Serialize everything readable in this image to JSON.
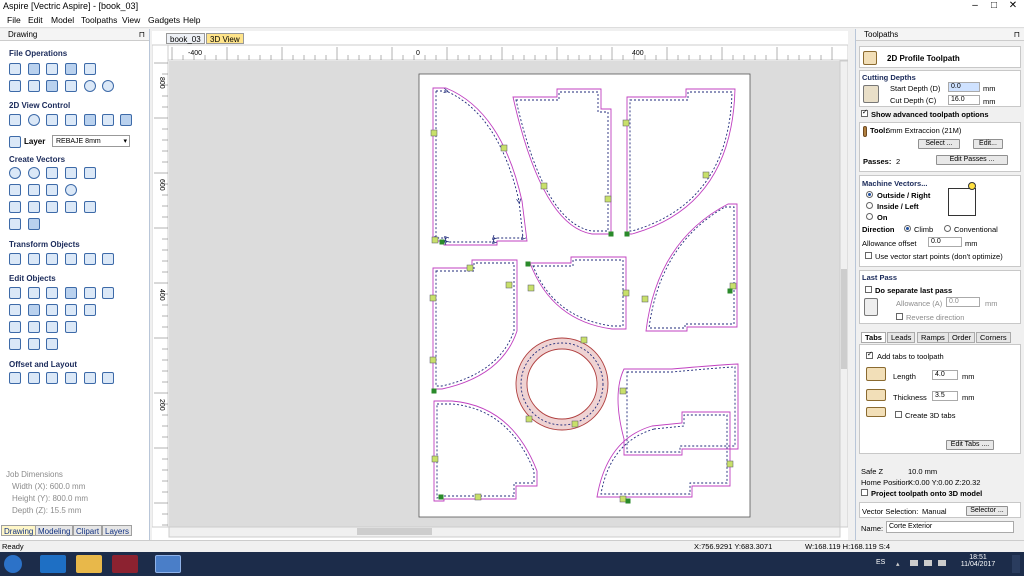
{
  "window": {
    "title": "Aspire [Vectric Aspire] - [book_03]",
    "min": "–",
    "max": "□",
    "close": "✕"
  },
  "menu": [
    "File",
    "Edit",
    "Model",
    "Toolpaths",
    "View",
    "Gadgets",
    "Help"
  ],
  "left": {
    "header": "Drawing",
    "pin": "⊓",
    "sections": {
      "file": "File Operations",
      "view2d": "2D View Control",
      "create": "Create Vectors",
      "transform": "Transform Objects",
      "edit": "Edit Objects",
      "offset": "Offset and Layout"
    },
    "layer_label": "Layer",
    "layer_value": "REBAJE 8mm",
    "job": {
      "title": "Job Dimensions",
      "width": "Width  (X): 600.0 mm",
      "height": "Height (Y): 800.0 mm",
      "depth": "Depth  (Z): 15.5 mm"
    },
    "tabs": [
      "Drawing",
      "Modeling",
      "Clipart",
      "Layers"
    ]
  },
  "doc": {
    "tabs": [
      "book_03",
      "3D View"
    ],
    "hruler": [
      "-400",
      "0",
      "400"
    ],
    "vruler": [
      "800",
      "600",
      "400",
      "200"
    ]
  },
  "right": {
    "header": "Toolpaths",
    "pin": "⊓",
    "title": "2D Profile Toolpath",
    "cutting": {
      "heading": "Cutting Depths",
      "start_label": "Start Depth (D)",
      "start_val": "0.0",
      "cut_label": "Cut Depth (C)",
      "cut_val": "16.0",
      "unit": "mm"
    },
    "adv": "Show advanced toolpath options",
    "tool": {
      "label": "Tool:",
      "name": "6mm Extraccion (21M)",
      "select": "Select ...",
      "edit": "Edit...",
      "passes_label": "Passes:",
      "passes_val": "2",
      "edit_passes": "Edit Passes ..."
    },
    "machine": {
      "heading": "Machine Vectors...",
      "outside": "Outside / Right",
      "inside": "Inside / Left",
      "on": "On",
      "direction": "Direction",
      "climb": "Climb",
      "conventional": "Conventional",
      "allowance_label": "Allowance offset",
      "allowance_val": "0.0",
      "unit": "mm",
      "start_points": "Use vector start points (don't optimize)"
    },
    "lastpass": {
      "heading": "Last Pass",
      "separate": "Do separate last pass",
      "allowance_label": "Allowance (A)",
      "allowance_val": "0.0",
      "unit": "mm",
      "reverse": "Reverse direction"
    },
    "tabs": [
      "Tabs",
      "Leads",
      "Ramps",
      "Order",
      "Corners"
    ],
    "tabsbox": {
      "add": "Add tabs to toolpath",
      "length_label": "Length",
      "length_val": "4.0",
      "thick_label": "Thickness",
      "thick_val": "3.5",
      "unit": "mm",
      "create3d": "Create 3D tabs",
      "edit_tabs": "Edit Tabs ...."
    },
    "safez": {
      "label": "Safe Z",
      "val": "10.0 mm"
    },
    "home": {
      "label": "Home Position",
      "val": "X:0.00 Y:0.00 Z:20.32"
    },
    "project": "Project toolpath onto 3D model",
    "vsel": {
      "label": "Vector Selection:",
      "val": "Manual",
      "btn": "Selector ..."
    },
    "name": {
      "label": "Name:",
      "val": "Corte Exterior"
    }
  },
  "status": {
    "ready": "Ready",
    "coords": "X:756.9291 Y:683.3071",
    "size": "W:168.119  H:168.119  S:4"
  },
  "taskbar": {
    "lang": "ES",
    "time": "18:51",
    "date": "11/04/2017"
  },
  "colors": {
    "vector": "#c040c0",
    "toolpath": "#1f2a7a",
    "tab_marker": "#c8e06a",
    "start_marker": "#2a8a2a"
  }
}
